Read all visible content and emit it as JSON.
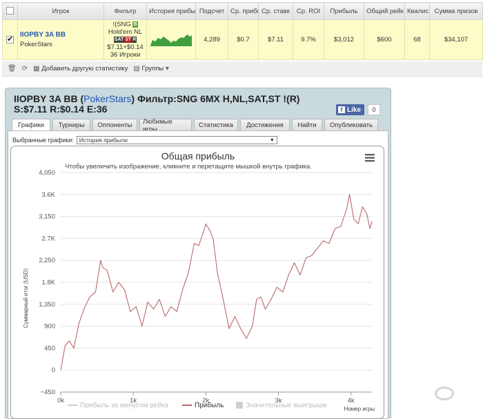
{
  "table": {
    "headers": [
      "",
      "Игрок",
      "Фильтр",
      "История прибы",
      "Подсчет",
      "Ср. прибы",
      "Ср. ставк",
      "Ср. ROI",
      "Прибыль",
      "Общий рейк",
      "Квалис",
      "Сумма призов"
    ],
    "row": {
      "checked": true,
      "player": "IIOPBY 3A BB",
      "site": "PokerStars",
      "filter_line1": "!(SNG",
      "filter_line2": "Hold'em NL",
      "filter_tag_sat": "SAT",
      "filter_tag_st": "ST",
      "filter_line3": "$7.11+$0.14",
      "filter_line4": "36 Игроки",
      "count": "4,289",
      "avg_profit": "$0.7",
      "avg_stake": "$7.11",
      "avg_roi": "9.7%",
      "profit": "$3,012",
      "total_rake": "$600",
      "quals": "68",
      "prize_sum": "$34,107"
    }
  },
  "toolbar": {
    "add_stat_label": "Добавить другую статистику",
    "groups_label": "Группы"
  },
  "panel": {
    "title_prefix": "IIOPBY 3A BB (",
    "title_site": "PokerStars",
    "title_suffix": ") Фильтр:SNG 6MX H,NL,SAT,ST !(R) S:$7.11 R:$0.14 E:36",
    "fb_like": "Like",
    "fb_count": "0",
    "tabs": [
      "Графики",
      "Турниры",
      "Оппоненты",
      "Любимые игры",
      "Статистика",
      "Достижения",
      "Найти",
      "Опубликовать"
    ],
    "active_tab": 0,
    "select_label": "Выбранные графики:",
    "select_value": "История прибыли"
  },
  "chart_data": {
    "type": "line",
    "title": "Общая прибыль",
    "subtitle": "Чтобы увеличить изображение, кликните и перетащите мышкой внутрь графика.",
    "ylabel": "Суммарный итог (USD)",
    "xlabel": "Номер игры",
    "y_ticks": [
      "4,050",
      "3.6K",
      "3,150",
      "2.7K",
      "2,250",
      "1.8K",
      "1,350",
      "900",
      "450",
      "0",
      "−450"
    ],
    "y_tick_values": [
      4050,
      3600,
      3150,
      2700,
      2250,
      1800,
      1350,
      900,
      450,
      0,
      -450
    ],
    "x_ticks": [
      "0k",
      "1k",
      "2k",
      "3k",
      "4k"
    ],
    "x_tick_values": [
      0,
      1000,
      2000,
      3000,
      4000
    ],
    "xlim": [
      0,
      4289
    ],
    "ylim": [
      -450,
      4050
    ],
    "grid": true,
    "legend": [
      "Прибыль за минусом рейка",
      "Прибыль",
      "Значительные выигрыши"
    ],
    "legend_colors": [
      "#cfcfcf",
      "#b06666",
      "#cfcfcf"
    ],
    "series": [
      {
        "name": "Прибыль",
        "color": "#b86a6a",
        "x": [
          0,
          60,
          120,
          180,
          250,
          320,
          400,
          480,
          550,
          580,
          640,
          720,
          800,
          880,
          960,
          1040,
          1120,
          1200,
          1280,
          1360,
          1440,
          1520,
          1600,
          1680,
          1760,
          1840,
          1900,
          1960,
          2000,
          2060,
          2100,
          2160,
          2240,
          2320,
          2400,
          2480,
          2560,
          2640,
          2700,
          2760,
          2820,
          2900,
          2980,
          3060,
          3140,
          3220,
          3300,
          3380,
          3460,
          3540,
          3620,
          3700,
          3780,
          3860,
          3940,
          3980,
          4040,
          4100,
          4160,
          4220,
          4260,
          4289
        ],
        "y": [
          0,
          500,
          600,
          450,
          950,
          1250,
          1500,
          1600,
          2250,
          2100,
          2050,
          1600,
          1800,
          1650,
          1200,
          1300,
          900,
          1400,
          1250,
          1450,
          1100,
          1300,
          1200,
          1650,
          2000,
          2600,
          2550,
          2800,
          3000,
          2850,
          2700,
          2000,
          1450,
          850,
          1100,
          850,
          650,
          900,
          1450,
          1500,
          1250,
          1450,
          1700,
          1600,
          1950,
          2200,
          1950,
          2300,
          2350,
          2500,
          2650,
          2600,
          2900,
          2950,
          3300,
          3600,
          3100,
          3000,
          3350,
          3200,
          2900,
          3050
        ]
      }
    ]
  }
}
